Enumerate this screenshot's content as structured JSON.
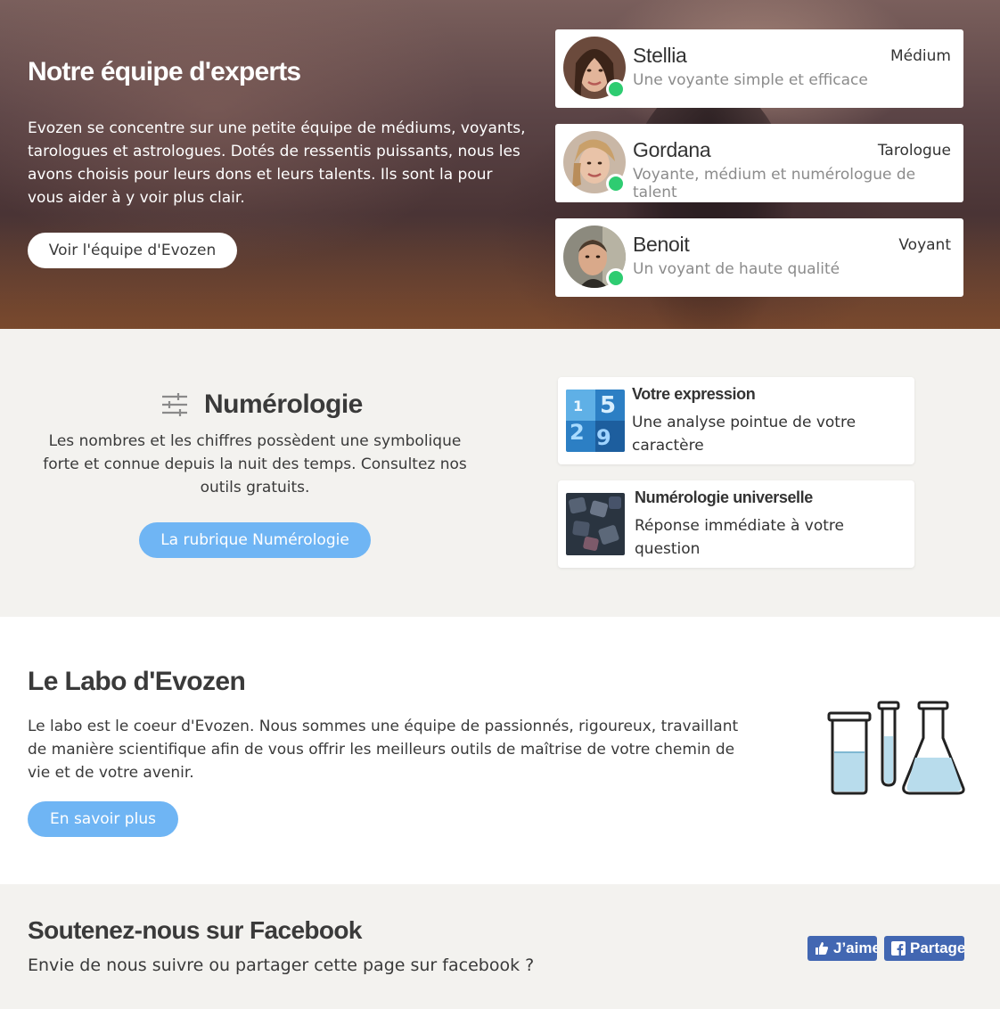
{
  "experts_section": {
    "title": "Notre équipe d'experts",
    "description": "Evozen se concentre sur une petite équipe de médiums, voyants, tarologues et astrologues. Dotés de ressentis puissants, nous les avons choisis pour leurs dons et leurs talents. Ils sont la pour vous aider à y voir plus clair.",
    "button_label": "Voir l'équipe d'Evozen",
    "experts": [
      {
        "name": "Stellia",
        "role": "Médium",
        "tagline": "Une voyante simple et efficace",
        "status": "online"
      },
      {
        "name": "Gordana",
        "role": "Tarologue",
        "tagline": "Voyante, médium et numérologue de talent",
        "status": "online"
      },
      {
        "name": "Benoit",
        "role": "Voyant",
        "tagline": "Un voyant de haute qualité",
        "status": "online"
      }
    ],
    "colors": {
      "online": "#2ecc71"
    }
  },
  "numerologie_section": {
    "icon": "sliders-icon",
    "title": "Numérologie",
    "description": "Les nombres et les chiffres possèdent une symbolique forte et connue depuis la nuit des temps. Consultez nos outils gratuits.",
    "button_label": "La rubrique Numérologie",
    "tools": [
      {
        "title": "Votre expression",
        "description": "Une analyse pointue de votre caractère"
      },
      {
        "title": "Numérologie universelle",
        "description": "Réponse immédiate à votre question"
      }
    ],
    "colors": {
      "accent": "#6fb5f4",
      "background": "#f3f2ef"
    }
  },
  "labo_section": {
    "title": "Le Labo d'Evozen",
    "description": "Le labo est le coeur d'Evozen. Nous sommes une équipe de passionnés, rigoureux, travaillant de manière scientifique afin de vous offrir les meilleurs outils de maîtrise de votre chemin de vie et de votre avenir.",
    "button_label": "En savoir plus",
    "illustration": "lab-flasks-icon"
  },
  "facebook_section": {
    "title": "Soutenez-nous sur Facebook",
    "description": "Envie de nous suivre ou partager cette page sur facebook ?",
    "like_label": "J’aime",
    "share_label": "Partager",
    "colors": {
      "facebook": "#4267b2"
    }
  }
}
